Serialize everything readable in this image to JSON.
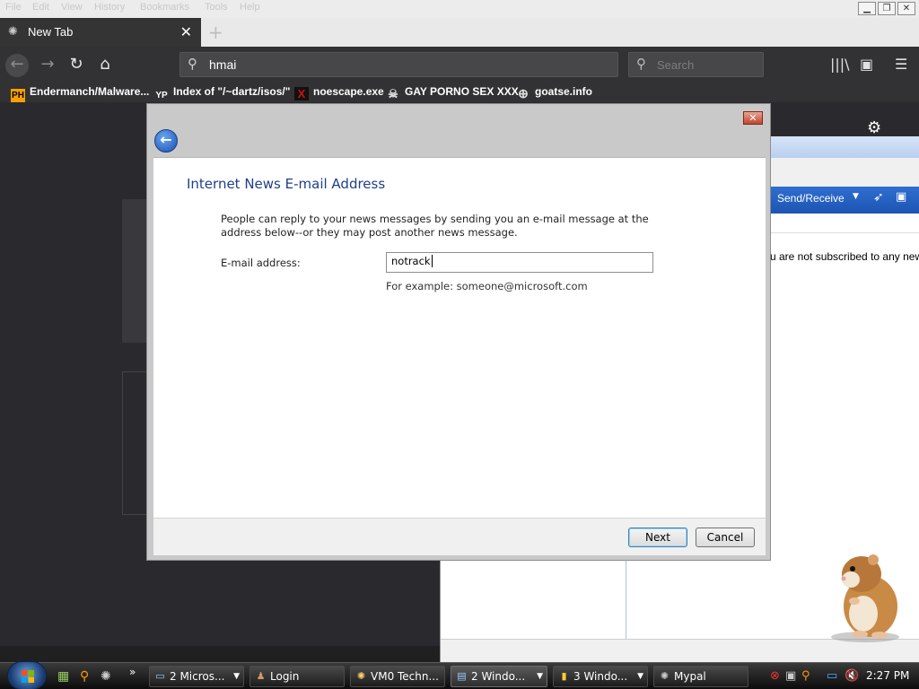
{
  "menubar": {
    "items": [
      "File",
      "Edit",
      "View",
      "History",
      "Bookmarks",
      "Tools",
      "Help"
    ],
    "minimize": "▁",
    "restore": "❐",
    "close": "✕"
  },
  "tabbar": {
    "tab_title": "New Tab",
    "tab_close": "✕",
    "new_tab": "+"
  },
  "navbar": {
    "url_value": "hmai",
    "search_placeholder": "Search"
  },
  "bookmarks": [
    {
      "label": "Endermanch/Malware...",
      "icon": "PH",
      "color": "#f5a000"
    },
    {
      "label": "Index of \"/~dartz/isos/\"",
      "icon": "YP",
      "color": "#222222"
    },
    {
      "label": "noescape.exe",
      "icon": "X",
      "color": "#d01010"
    },
    {
      "label": "GAY PORNO SEX XXX",
      "icon": "☠",
      "color": "#323234"
    },
    {
      "label": "goatse.info",
      "icon": "⊕",
      "color": "#323234"
    }
  ],
  "background_app": {
    "send_receive": "Send/Receive",
    "message": "u are not subscribed to any new"
  },
  "dialog": {
    "title": "Internet News E-mail Address",
    "description": "People can reply to your news messages by sending you an e-mail message at the address below--or they may post another news message.",
    "email_label": "E-mail address:",
    "email_value": "notrack",
    "email_example": "For example: someone@microsoft.com",
    "next_label": "Next",
    "cancel_label": "Cancel",
    "close_glyph": "✕",
    "back_glyph": "←"
  },
  "taskbar": {
    "buttons": [
      {
        "label": "2 Micros...",
        "icon": "▭",
        "dropdown": true,
        "active": false
      },
      {
        "label": "Login",
        "icon": "♟",
        "dropdown": false,
        "active": false
      },
      {
        "label": "VM0 Techn...",
        "icon": "✺",
        "dropdown": false,
        "active": false
      },
      {
        "label": "2 Windo...",
        "icon": "▤",
        "dropdown": true,
        "active": true
      },
      {
        "label": "3 Windo...",
        "icon": "▮",
        "dropdown": true,
        "active": false
      },
      {
        "label": "Mypal",
        "icon": "✺",
        "dropdown": false,
        "active": false
      }
    ],
    "clock": "2:27 PM",
    "overflow": "»"
  }
}
